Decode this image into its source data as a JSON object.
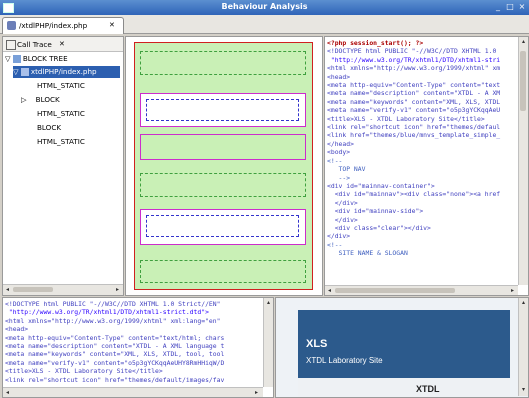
{
  "window": {
    "title": "Behaviour Analysis",
    "min_btn": "_",
    "restore_btn": "□",
    "close_btn": "×"
  },
  "editor_tab": {
    "label": "/xtdlPHP/index.php",
    "close": "✕"
  },
  "call_trace": {
    "title": "Call Trace",
    "close": "✕",
    "items": [
      {
        "label": "BLOCK TREE"
      },
      {
        "label": "xtdlPHP/index.php"
      },
      {
        "label": "HTML_STATIC"
      },
      {
        "label": "BLOCK"
      },
      {
        "label": "HTML_STATIC"
      },
      {
        "label": "BLOCK"
      },
      {
        "label": "HTML_STATIC"
      }
    ]
  },
  "source_right": {
    "lines": [
      "<?php session_start(); ?>",
      "<!DOCTYPE html PUBLIC \"-//W3C//DTD XHTML 1.0",
      " \"http://www.w3.org/TR/xhtml1/DTD/xhtml1-stri",
      "<html xmlns=\"http://www.w3.org/1999/xhtml\" xm",
      "<head>",
      "<meta http-equiv=\"Content-Type\" content=\"text",
      "<meta name=\"description\" content=\"XTDL - A XM",
      "<meta name=\"keywords\" content=\"XML, XLS, XTDL",
      "<meta name=\"verify-v1\" content=\"o5p3gYCKqqAeU",
      "<title>XLS - XTDL Laboratory Site</title>",
      "<link rel=\"shortcut icon\" href=\"themes/defaul",
      "<link href=\"themes/blue/mnvs_template_simple_",
      "</head>",
      "<body>",
      "<!--",
      "",
      "   TOP NAV",
      "",
      "   -->",
      "<div id=\"mainnav-container\">",
      "  <div id=\"mainnav\"><div class=\"none\"><a href",
      "  </div>",
      "  <div id=\"mainnav-side\">",
      "  </div>",
      "  <div class=\"clear\"></div>",
      "</div>",
      "<!--",
      "",
      "   SITE NAME & SLOGAN"
    ]
  },
  "source_bottom": {
    "lines": [
      "<!DOCTYPE html PUBLIC \"-//W3C//DTD XHTML 1.0 Strict//EN\"",
      " \"http://www.w3.org/TR/xhtml1/DTD/xhtml1-strict.dtd\">",
      "<html xmlns=\"http://www.w3.org/1999/xhtml\" xml:lang=\"en\"",
      "<head>",
      "<meta http-equiv=\"Content-Type\" content=\"text/html; chars",
      "<meta name=\"description\" content=\"XTDL - A XML language t",
      "<meta name=\"keywords\" content=\"XML, XLS, XTDL, tool, tool",
      "<meta name=\"verify-v1\" content=\"o5p3gYCKqqAeUHY8RmHHiqW/D",
      "<title>XLS - XTDL Laboratory Site</title>",
      "<link rel=\"shortcut icon\" href=\"themes/default/images/fav"
    ]
  },
  "preview": {
    "site_title": "XLS",
    "site_subtitle": "XTDL Laboratory Site",
    "footer_label": "XTDL"
  },
  "colors": {
    "accent": "#2c5fb0",
    "layout_fill": "#c9f0b6",
    "layout_dash": "#3fa03f",
    "block_border": "#cc2ccc",
    "inner_dash": "#3333cc",
    "page_border": "#d02020",
    "preview_bg": "#2c5a8c"
  }
}
